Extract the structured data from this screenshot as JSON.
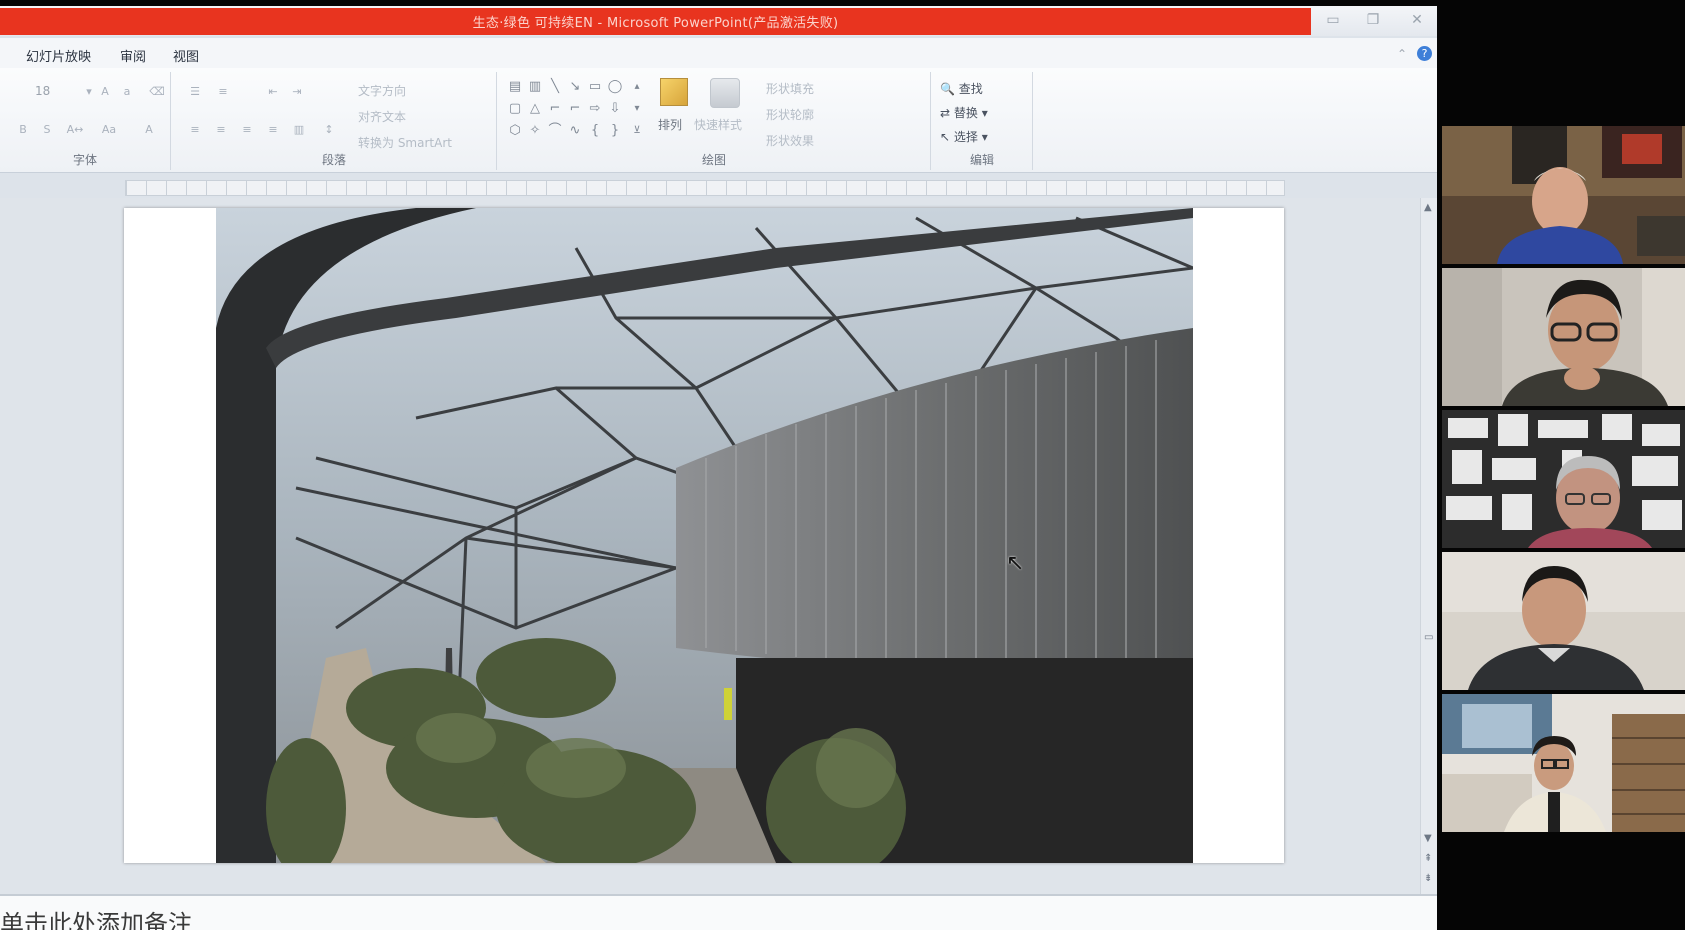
{
  "window": {
    "title": "生态·绿色 可持续EN - Microsoft PowerPoint(产品激活失败)",
    "controls": {
      "minimize": "▭",
      "restore": "❐",
      "close": "✕"
    }
  },
  "menu": {
    "tabs": [
      "幻灯片放映",
      "审阅",
      "视图"
    ],
    "help": "?"
  },
  "ribbon": {
    "groups": [
      "字体",
      "段落",
      "绘图",
      "编辑"
    ],
    "font_size": "18",
    "paragraph_buttons": [
      "文字方向",
      "对齐文本",
      "转换为 SmartArt"
    ],
    "drawing_buttons": [
      "排列",
      "快速样式"
    ],
    "shape_style_buttons": [
      "形状填充",
      "形状轮廓",
      "形状效果"
    ],
    "editing_buttons": [
      "查找",
      "替换",
      "选择"
    ]
  },
  "slide": {
    "image_description_icon": "photo-atrium"
  },
  "notes": {
    "placeholder": "单击此处添加备注"
  },
  "participants": [
    {
      "tile": "participant-1"
    },
    {
      "tile": "participant-2"
    },
    {
      "tile": "participant-3"
    },
    {
      "tile": "participant-4"
    },
    {
      "tile": "participant-5"
    }
  ],
  "colors": {
    "title_red": "#e8341f",
    "ribbon_bg": "#f4f6f9",
    "help_blue": "#3e7fd8"
  }
}
